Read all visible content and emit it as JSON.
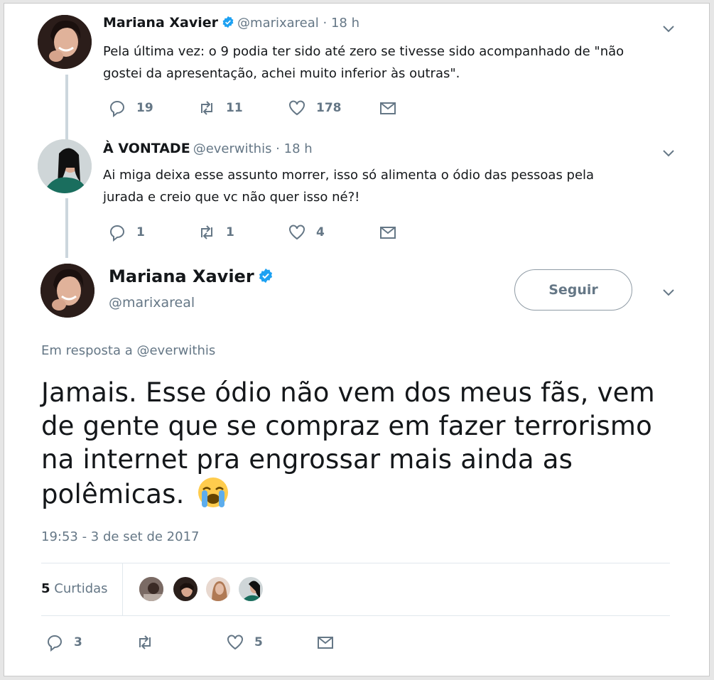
{
  "thread": [
    {
      "name": "Mariana Xavier",
      "verified": true,
      "handle": "@marixareal · 18 h",
      "text_line1": "Pela última vez: o 9 podia ter sido até zero se tivesse sido acompanhado de \"não",
      "text_line2": "gostei da apresentação, achei muito inferior às outras\".",
      "replies": "19",
      "retweets": "11",
      "likes": "178"
    },
    {
      "name": "À VONTADE",
      "verified": false,
      "handle": "@everwithis · 18 h",
      "text_line1": "Ai miga deixa esse assunto morrer, isso só alimenta o ódio das pessoas pela",
      "text_line2": "jurada e creio que vc não quer isso né?!",
      "replies": "1",
      "retweets": "1",
      "likes": "4"
    }
  ],
  "main_tweet": {
    "name": "Mariana Xavier",
    "handle": "@marixareal",
    "follow_label": "Seguir",
    "reply_prefix": "Em resposta a",
    "reply_to": "@everwithis",
    "text_line1": "Jamais. Esse ódio não vem dos meus fãs, vem",
    "text_line2": "de gente que se compraz em fazer terrorismo",
    "text_line3": "na internet pra engrossar mais ainda as",
    "text_line4": "polêmicas.",
    "emoji": "loudly-crying-face",
    "timestamp": "19:53 - 3 de set de 2017",
    "likes_count": "5",
    "likes_label": "Curtidas",
    "replies": "3",
    "retweets": "",
    "likes": "5"
  },
  "colors": {
    "verified": "#1da1f2",
    "muted": "#657786",
    "text": "#14171a",
    "thread_line": "#ccd6dd"
  }
}
